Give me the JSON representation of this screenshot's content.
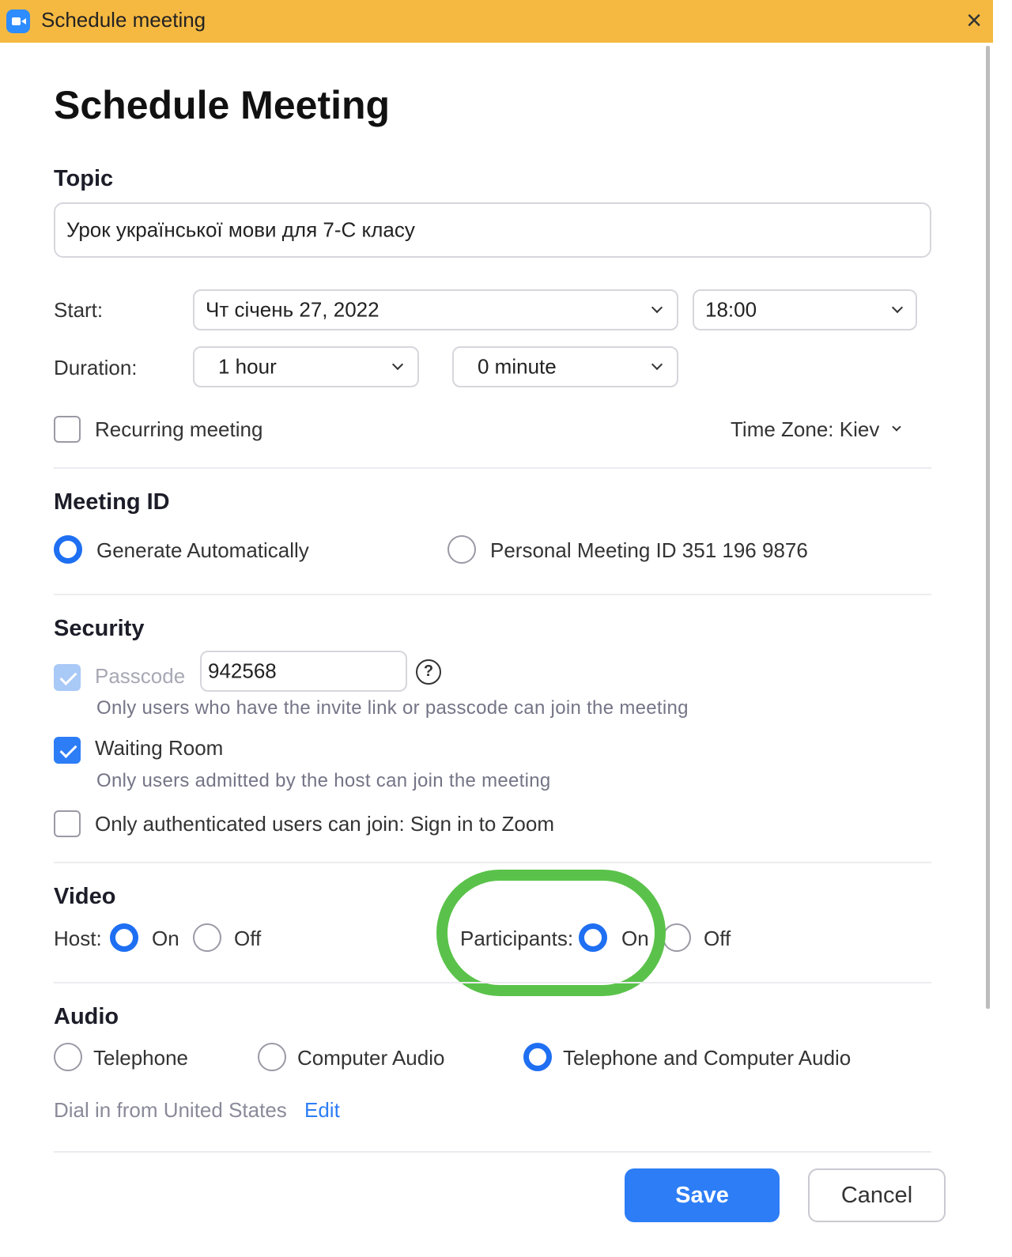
{
  "window": {
    "title": "Schedule meeting",
    "close_symbol": "×"
  },
  "page_title": "Schedule Meeting",
  "topic": {
    "label": "Topic",
    "value": "Урок української мови для 7-С класу"
  },
  "start": {
    "label": "Start:",
    "date": "Чт  січень  27,  2022",
    "time": "18:00"
  },
  "duration": {
    "label": "Duration:",
    "hours": "1 hour",
    "minutes": "0 minute"
  },
  "recurring": {
    "label": "Recurring meeting",
    "checked": false
  },
  "timezone": {
    "label": "Time Zone: Kiev"
  },
  "meeting_id": {
    "heading": "Meeting ID",
    "options": [
      {
        "label": "Generate Automatically",
        "selected": true
      },
      {
        "label": "Personal Meeting ID 351 196 9876",
        "selected": false
      }
    ]
  },
  "security": {
    "heading": "Security",
    "passcode_label": "Passcode",
    "passcode_value": "942568",
    "help_symbol": "?",
    "passcode_hint": "Only users who have the invite link or passcode can join the meeting",
    "waiting_room_label": "Waiting Room",
    "waiting_room_hint": "Only users admitted by the host can join the meeting",
    "auth_label": "Only authenticated users can join: Sign in to Zoom"
  },
  "video": {
    "heading": "Video",
    "host_label": "Host:",
    "participants_label": "Participants:",
    "on_label": "On",
    "off_label": "Off",
    "host_on": true,
    "participants_on": true
  },
  "audio": {
    "heading": "Audio",
    "options": [
      {
        "label": "Telephone",
        "selected": false
      },
      {
        "label": "Computer Audio",
        "selected": false
      },
      {
        "label": "Telephone and Computer Audio",
        "selected": true
      }
    ],
    "dial_in_text": "Dial in from United States",
    "edit_label": "Edit"
  },
  "buttons": {
    "save": "Save",
    "cancel": "Cancel"
  },
  "colors": {
    "titlebar": "#f5b942",
    "accent": "#2d7df6",
    "highlight": "#5ac24a"
  }
}
